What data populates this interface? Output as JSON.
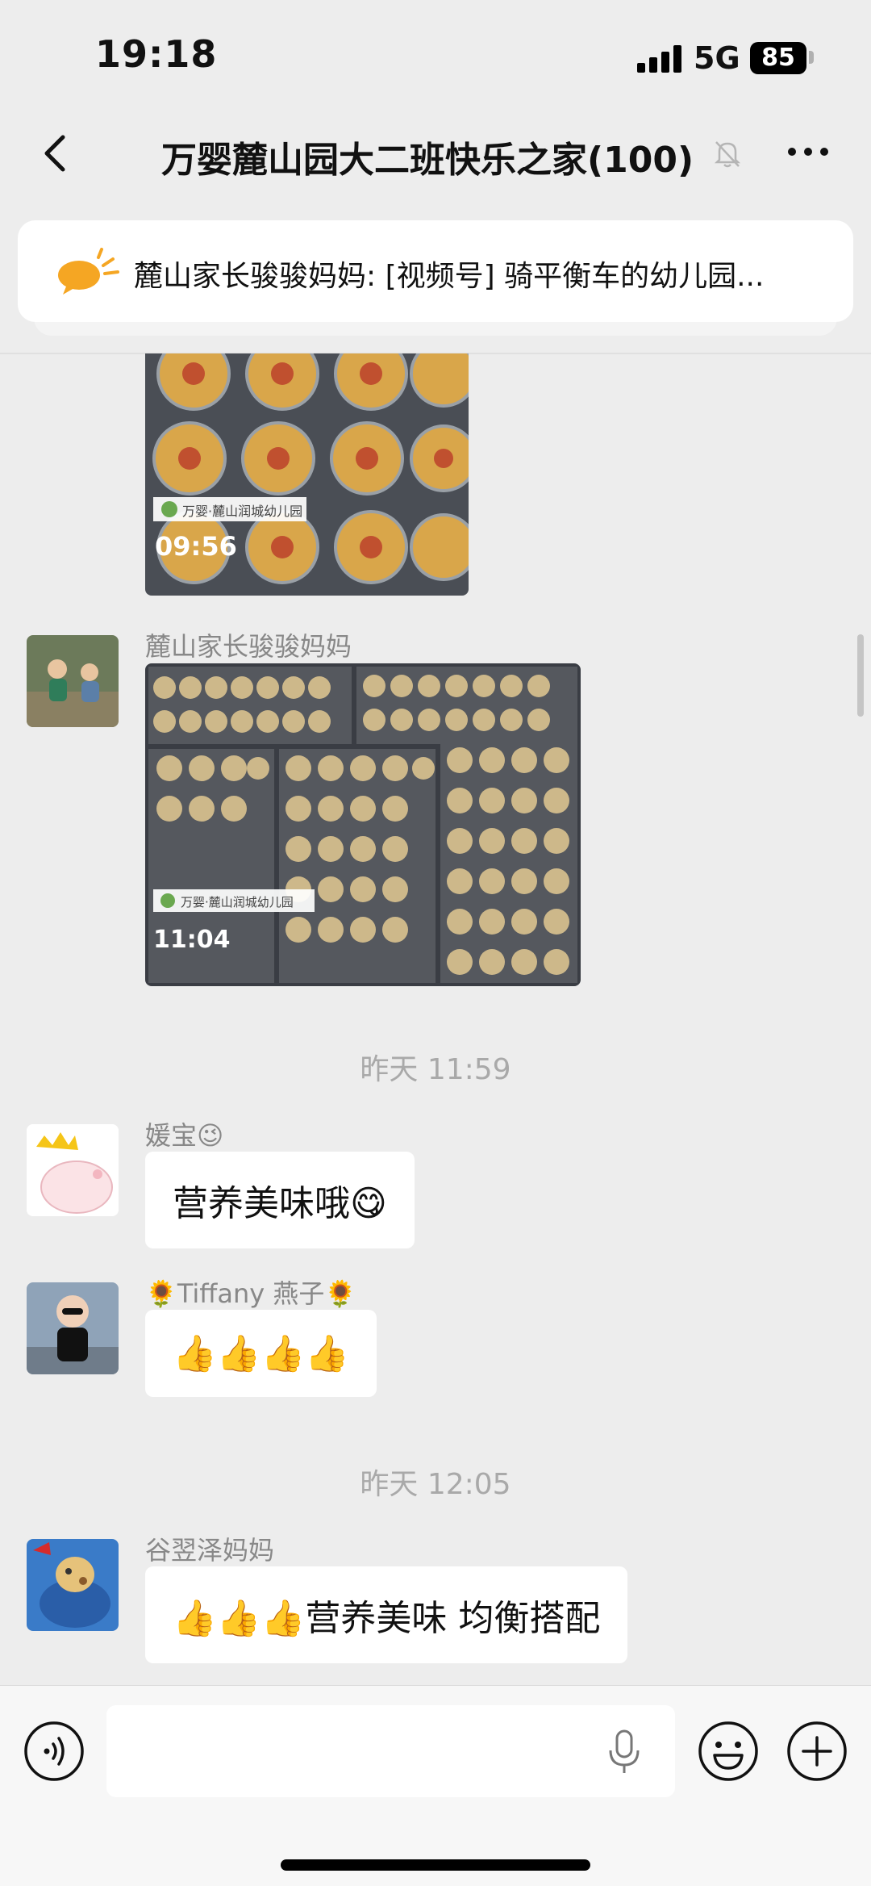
{
  "status_bar": {
    "time": "19:18",
    "network": "5G",
    "battery": "85"
  },
  "nav": {
    "title": "万婴麓山园大二班快乐之家(100)"
  },
  "notice": {
    "text": "麓山家长骏骏妈妈: [视频号] 骑平衡车的幼儿园..."
  },
  "messages": {
    "photo1": {
      "stamp_time": "09:56",
      "brand": "万婴·麓山润城幼儿园"
    },
    "photo2": {
      "sender": "麓山家长骏骏妈妈",
      "stamp_time": "11:04",
      "brand": "万婴·麓山润城幼儿园"
    },
    "ts1": "昨天 11:59",
    "msg3": {
      "sender": "媛宝😉",
      "text": "营养美味哦😋"
    },
    "msg4": {
      "sender": "🌻Tiffany 燕子🌻",
      "text": "👍👍👍👍"
    },
    "ts2": "昨天 12:05",
    "msg5": {
      "sender": "谷翌泽妈妈",
      "text": "👍👍👍营养美味 均衡搭配"
    }
  },
  "colors": {
    "background": "#ededed",
    "bubble": "#ffffff",
    "notice_icon": "#f5a623"
  },
  "icons": [
    "back-icon",
    "mute-icon",
    "more-icon",
    "megaphone-icon",
    "voice-icon",
    "mic-icon",
    "emoji-icon",
    "plus-icon"
  ]
}
